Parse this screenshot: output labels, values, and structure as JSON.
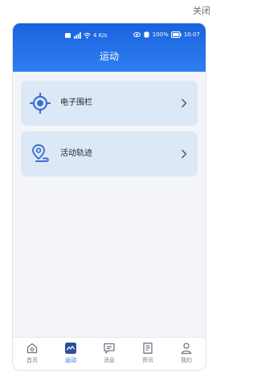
{
  "topbar": {
    "close_label": "关闭"
  },
  "statusbar": {
    "network_small": "4",
    "network_rate": "K/s",
    "battery": "100%",
    "time": "10:07"
  },
  "header": {
    "title": "运动"
  },
  "menu": {
    "items": [
      {
        "label": "电子围栏",
        "icon": "geofence-target-icon"
      },
      {
        "label": "活动轨迹",
        "icon": "location-route-icon"
      }
    ]
  },
  "tabbar": {
    "active_index": 1,
    "tabs": [
      {
        "label": "首页",
        "icon": "home-icon"
      },
      {
        "label": "运动",
        "icon": "activity-chart-icon"
      },
      {
        "label": "消息",
        "icon": "message-icon"
      },
      {
        "label": "资讯",
        "icon": "news-icon"
      },
      {
        "label": "我的",
        "icon": "profile-icon"
      }
    ]
  },
  "colors": {
    "accent": "#1f6fe6",
    "header_top": "#1a63dd",
    "header_bottom": "#2f7ef2",
    "card_bg": "#dde8f7",
    "page_bg": "#f4f5f8"
  }
}
